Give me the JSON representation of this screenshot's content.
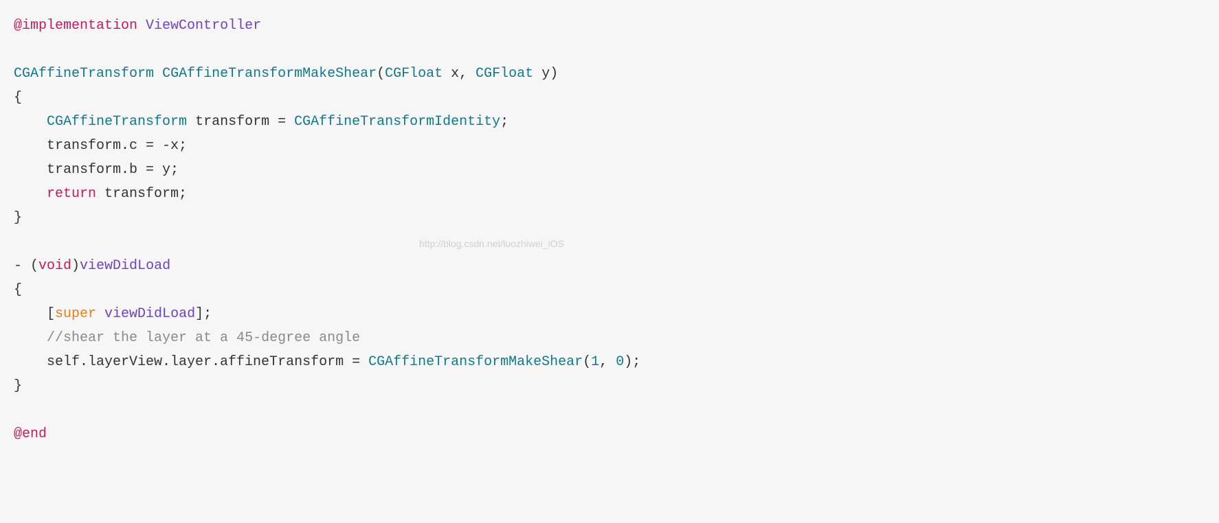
{
  "code": {
    "line1": {
      "impl": "@implementation",
      "className": "ViewController"
    },
    "line3": {
      "returnType": "CGAffineTransform",
      "funcName": "CGAffineTransformMakeShear",
      "paren1": "(",
      "paramType1": "CGFloat",
      "paramName1": " x, ",
      "paramType2": "CGFloat",
      "paramName2": " y)"
    },
    "line4": "{",
    "line5": {
      "indent": "    ",
      "type": "CGAffineTransform",
      "rest": " transform = ",
      "identity": "CGAffineTransformIdentity",
      "semi": ";"
    },
    "line6": "    transform.c = -x;",
    "line7": "    transform.b = y;",
    "line8": {
      "indent": "    ",
      "return": "return",
      "rest": " transform;"
    },
    "line9": "}",
    "line11": {
      "dash": "- (",
      "void": "void",
      "paren": ")",
      "method": "viewDidLoad"
    },
    "line12": "{",
    "line13": {
      "indent": "    [",
      "super": "super",
      "space": " ",
      "method": "viewDidLoad",
      "rest": "];"
    },
    "line14": {
      "indent": "    ",
      "comment": "//shear the layer at a 45-degree angle"
    },
    "line15": {
      "indent": "    self.layerView.layer.affineTransform = ",
      "func": "CGAffineTransformMakeShear",
      "paren1": "(",
      "num1": "1",
      "comma": ", ",
      "num2": "0",
      "paren2": ");"
    },
    "line16": "}",
    "line18": "@end",
    "watermark": "http://blog.csdn.net/luozhiwei_iOS"
  }
}
